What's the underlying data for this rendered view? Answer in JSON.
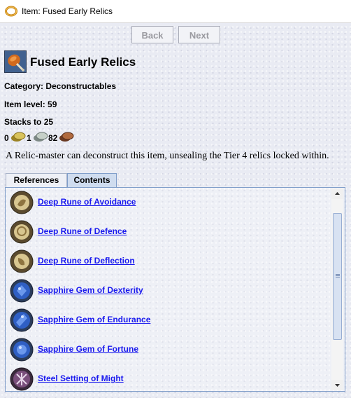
{
  "window": {
    "title": "Item: Fused Early Relics",
    "title_icon": "ring-icon"
  },
  "nav": {
    "back_label": "Back",
    "next_label": "Next"
  },
  "item": {
    "name": "Fused Early Relics",
    "icon": "relic-satchel-icon",
    "category": "Category: Deconstructables",
    "item_level": "Item level: 59",
    "stacks": "Stacks to 25",
    "value": {
      "gold": "0",
      "silver": "1",
      "copper": "82",
      "gold_icon": "gold-coin-icon",
      "silver_icon": "silver-coin-icon",
      "copper_icon": "copper-coin-icon"
    },
    "description": "A Relic-master can deconstruct this item, unsealing the Tier 4 relics locked within."
  },
  "tabs": [
    {
      "label": "References",
      "active": false
    },
    {
      "label": "Contents",
      "active": true
    }
  ],
  "contents": [
    {
      "label": "Deep Rune of Avoidance",
      "icon": "rune-icon",
      "color": "#b89a5a"
    },
    {
      "label": "Deep Rune of Defence",
      "icon": "rune-icon",
      "color": "#b89a5a"
    },
    {
      "label": "Deep Rune of Deflection",
      "icon": "rune-icon",
      "color": "#b89a5a"
    },
    {
      "label": "Sapphire Gem of Dexterity",
      "icon": "gem-icon",
      "color": "#2f5fc4"
    },
    {
      "label": "Sapphire Gem of Endurance",
      "icon": "gem-icon",
      "color": "#2f5fc4"
    },
    {
      "label": "Sapphire Gem of Fortune",
      "icon": "gem-icon",
      "color": "#2f5fc4"
    },
    {
      "label": "Steel Setting of Might",
      "icon": "setting-icon",
      "color": "#7a4f7c"
    }
  ],
  "colors": {
    "link": "#1a1aee",
    "tab_active": "#cfdcef",
    "border_accent": "#7f9dc9"
  }
}
